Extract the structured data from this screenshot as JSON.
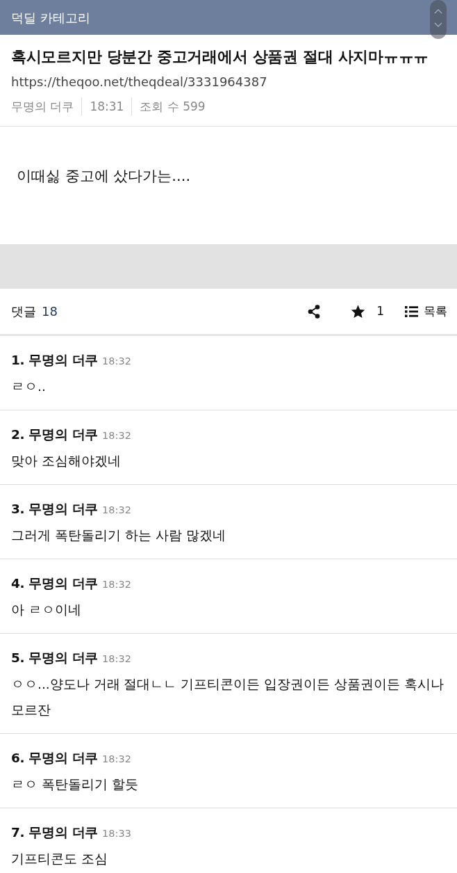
{
  "header": {
    "title": "덕딜 카테고리"
  },
  "post": {
    "title": "혹시모르지만 당분간 중고거래에서 상품권 절대 사지마ㅠㅠㅠ",
    "url": "https://theqoo.net/theqdeal/3331964387",
    "author": "무명의 더쿠",
    "time": "18:31",
    "views": "조회 수 599",
    "body": "이때싫 중고에 샀다가는...."
  },
  "comment_bar": {
    "label": "댓글",
    "count": "18",
    "star_count": "1",
    "list_label": "목록"
  },
  "comments": [
    {
      "heading": "1. 무명의 더쿠",
      "time": "18:32",
      "text": "ㄹㅇ.."
    },
    {
      "heading": "2. 무명의 더쿠",
      "time": "18:32",
      "text": "맞아 조심해야겠네"
    },
    {
      "heading": "3. 무명의 더쿠",
      "time": "18:32",
      "text": "그러게 폭탄돌리기 하는 사람 많겠네"
    },
    {
      "heading": "4. 무명의 더쿠",
      "time": "18:32",
      "text": "아 ㄹㅇ이네"
    },
    {
      "heading": "5. 무명의 더쿠",
      "time": "18:32",
      "text": "ㅇㅇ...양도나 거래 절대ㄴㄴ 기프티콘이든 입장권이든 상품권이든 혹시나 모르잔"
    },
    {
      "heading": "6. 무명의 더쿠",
      "time": "18:32",
      "text": "ㄹㅇ 폭탄돌리기 할듯"
    },
    {
      "heading": "7. 무명의 더쿠",
      "time": "18:33",
      "text": "기프티콘도 조심"
    }
  ]
}
